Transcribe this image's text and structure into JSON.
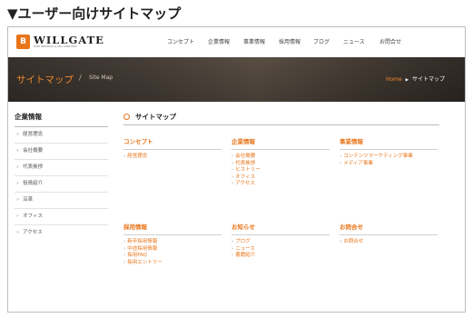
{
  "page_heading": "▼ユーザー向けサイトマップ",
  "logo": {
    "badge": "B",
    "name": "WILLGATE",
    "tagline": "MAKE INDIVIDUAL & WILL COME TRUE"
  },
  "nav": [
    "コンセプト",
    "企業情報",
    "事業情報",
    "採用情報",
    "ブログ",
    "ニュース",
    "お問合せ"
  ],
  "banner": {
    "title": "サイトマップ",
    "separator": "/",
    "subtitle": "Site Map",
    "crumb_home": "Home",
    "crumb_arrow": "▶",
    "crumb_current": "サイトマップ"
  },
  "sidebar": {
    "title": "企業情報",
    "chevron": "»",
    "items": [
      "経営理念",
      "会社概要",
      "代表挨拶",
      "役員紹介",
      "沿革",
      "オフィス",
      "アクセス"
    ]
  },
  "main": {
    "title": "サイトマップ",
    "link_arrow": "›",
    "sections": [
      {
        "heading": "コンセプト",
        "links": [
          "経営理念"
        ]
      },
      {
        "heading": "企業情報",
        "links": [
          "会社概要",
          "代表挨拶",
          "ヒストリー",
          "オフィス",
          "アクセス"
        ]
      },
      {
        "heading": "事業情報",
        "links": [
          "コンテンツマーケティング事業",
          "メディア事業"
        ]
      },
      {
        "heading": "採用情報",
        "links": [
          "新卒採用情報",
          "中途採用情報",
          "採用FAQ",
          "採用エントリー"
        ]
      },
      {
        "heading": "お知らせ",
        "links": [
          "ブログ",
          "ニュース",
          "書籍紹介"
        ]
      },
      {
        "heading": "お問合せ",
        "links": [
          "お問合せ"
        ]
      }
    ]
  },
  "colors": {
    "accent": "#e8751a",
    "banner": "#4a413a"
  }
}
